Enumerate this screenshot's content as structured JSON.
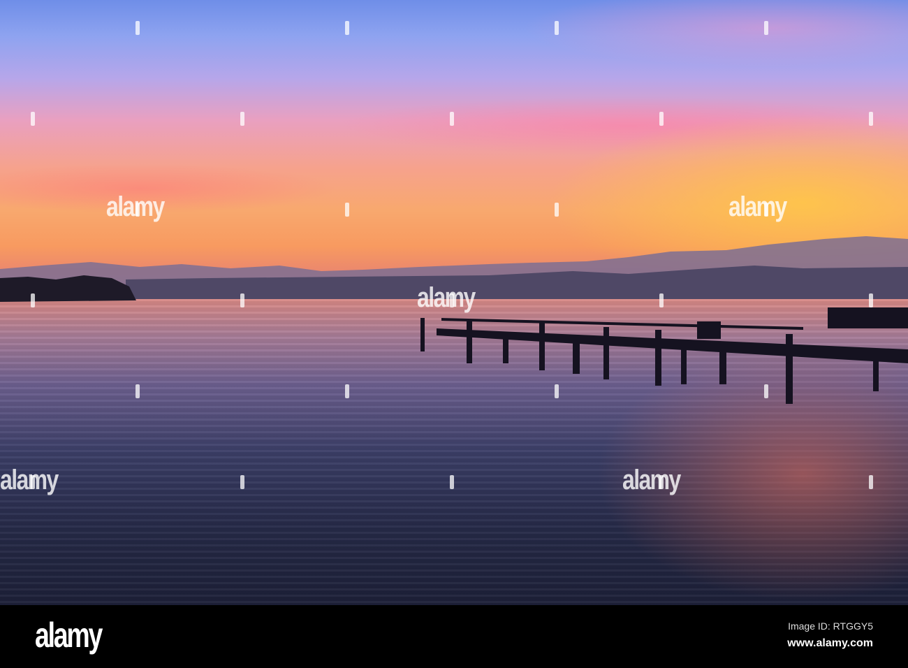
{
  "watermark": {
    "text": "alamy"
  },
  "footer": {
    "logo": "alamy",
    "image_id": "Image ID: RTGGY5",
    "website": "www.alamy.com"
  }
}
